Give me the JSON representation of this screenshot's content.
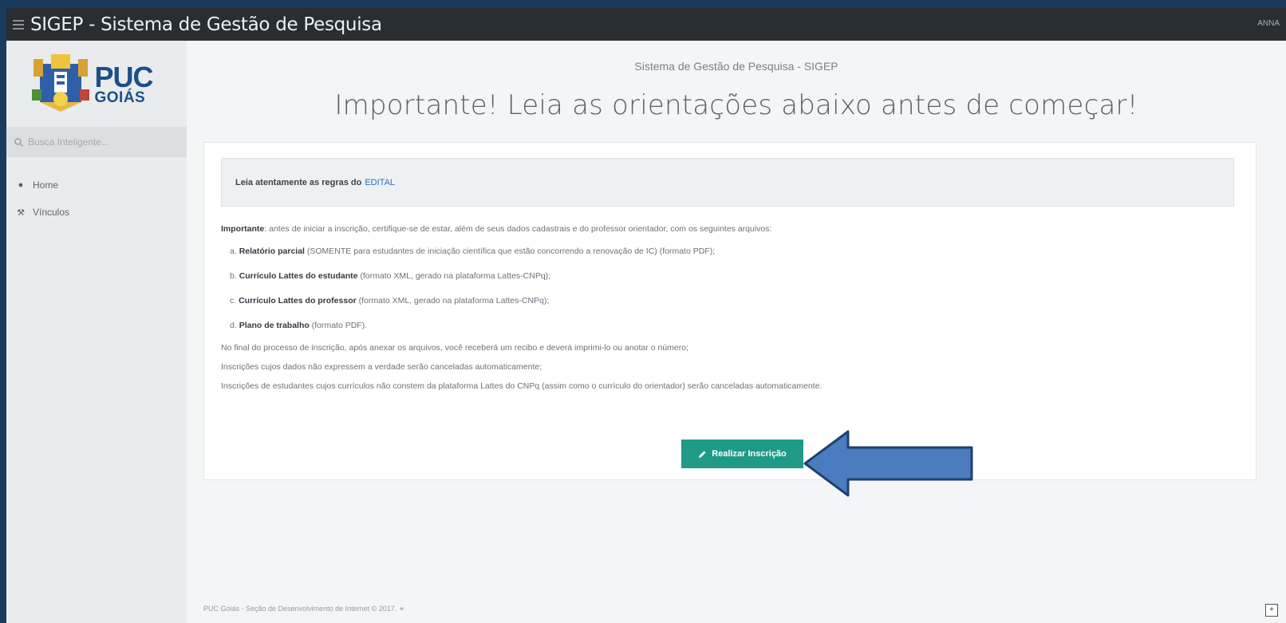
{
  "topbar": {
    "title": "SIGEP - Sistema de Gestão de Pesquisa",
    "user": "ANNA"
  },
  "sidebar": {
    "logo": {
      "name": "PUC",
      "sub": "GOIÁS"
    },
    "search_placeholder": "Busca Inteligente...",
    "items": [
      {
        "label": "Home",
        "icon": "home-icon"
      },
      {
        "label": "Vínculos",
        "icon": "wrench-icon"
      }
    ]
  },
  "main": {
    "subtitle": "Sistema de Gestão de Pesquisa - SIGEP",
    "headline": "Importante! Leia as orientações abaixo antes de começar!",
    "alert": {
      "text": "Leia atentamente as regras do",
      "link": "EDITAL"
    },
    "intro": {
      "bold": "Importante",
      "text": ": antes de iniciar a inscrição, certifique-se de estar, além de seus dados cadastrais e do professor orientador, com os seguintes arquivos:"
    },
    "list": [
      {
        "prefix": "a. ",
        "bold": "Relatório parcial",
        "text": " (SOMENTE para estudantes de iniciação científica que estão concorrendo a renovação de IC) (formato PDF);"
      },
      {
        "prefix": "b. ",
        "bold": "Currículo Lattes do estudante",
        "text": " (formato XML, gerado na plataforma Lattes-CNPq);"
      },
      {
        "prefix": "c. ",
        "bold": "Currículo Lattes do professor",
        "text": " (formato XML, gerado na plataforma Lattes-CNPq);"
      },
      {
        "prefix": "d. ",
        "bold": "Plano de trabalho",
        "text": " (formato PDF)."
      }
    ],
    "notes": [
      "No final do processo de inscrição, após anexar os arquivos, você receberá um recibo e deverá imprimi-lo ou anotar o número;",
      "Inscrições cujos dados não expressem a verdade serão canceladas automaticamente;",
      "Inscrições de estudantes cujos currículos não constem da plataforma Lattes do CNPq (assim como o currículo do orientador) serão canceladas automaticamente."
    ],
    "button": "Realizar Inscrição"
  },
  "footer": {
    "text": "PUC Goiás - Seção de Desenvolvimento de Internet © 2017. ⚭"
  },
  "colors": {
    "topbar": "#2a2e33",
    "button": "#1f9a86",
    "arrow": "#4a7cbf",
    "link": "#2a6ebc"
  }
}
